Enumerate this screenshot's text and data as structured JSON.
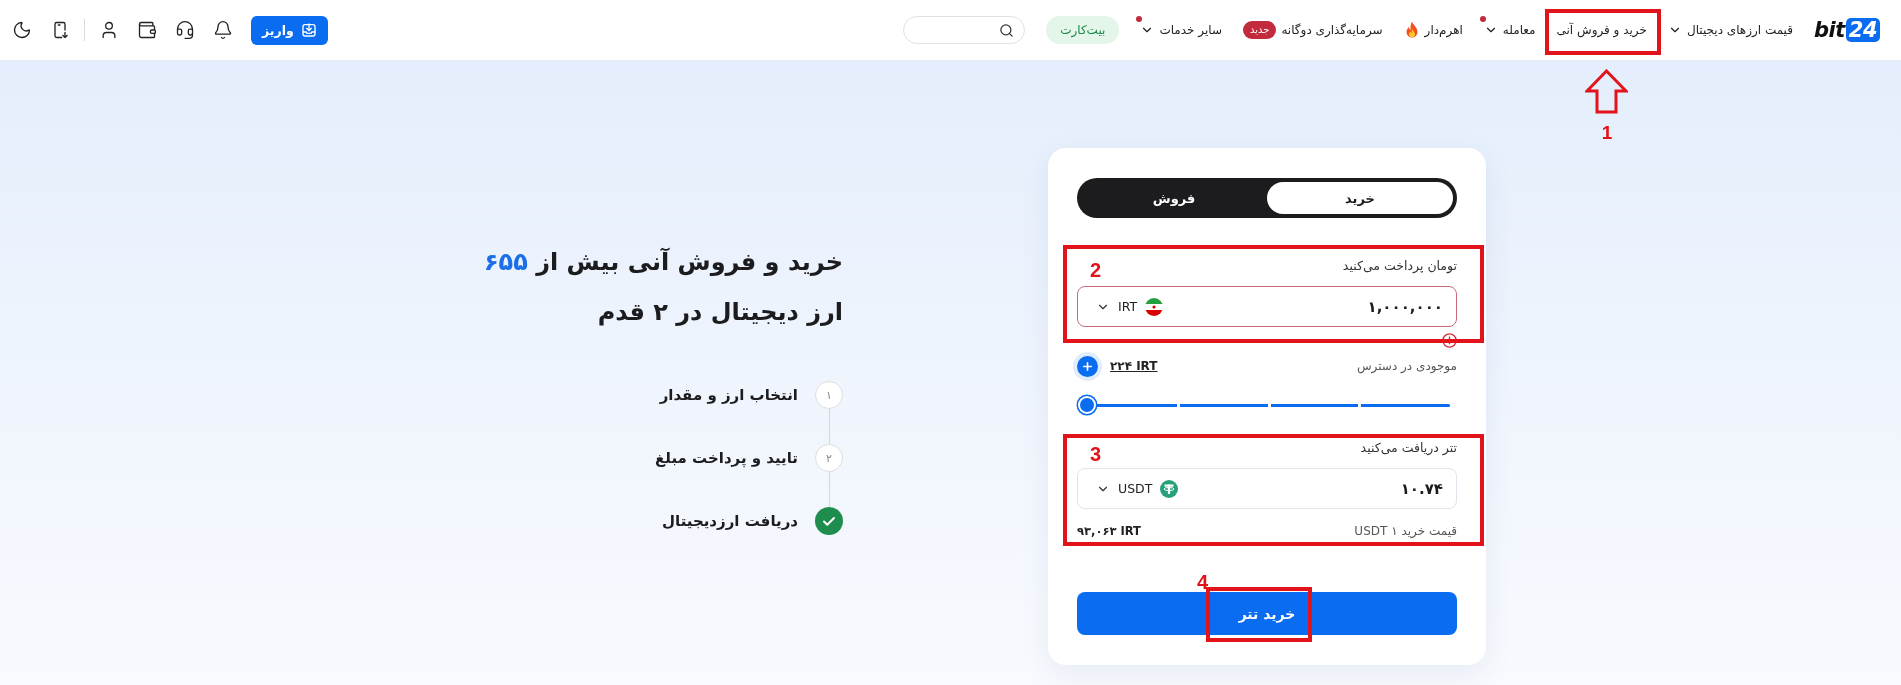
{
  "navbar": {
    "logo": {
      "word": "bit",
      "number": "24"
    },
    "menu": [
      {
        "label": "قیمت ارزهای دیجیتال",
        "kind": "dropdown",
        "dot": false
      },
      {
        "label": "خرید و فروش آنی",
        "kind": "link",
        "dot": false,
        "annotation": "1"
      },
      {
        "label": "معامله",
        "kind": "dropdown",
        "dot": true
      },
      {
        "label": "اهرم‌دار",
        "kind": "hot",
        "dot": false
      },
      {
        "label": "سرمایه‌گذاری دوگانه",
        "kind": "badge",
        "badge": "جدید",
        "dot": false
      },
      {
        "label": "سایر خدمات",
        "kind": "dropdown",
        "dot": true
      }
    ],
    "card_button": "بیت‌کارت",
    "deposit_button": "واریز"
  },
  "hero": {
    "title_start": "خرید و فروش آنی بیش از",
    "title_highlight": "۶۵۵",
    "title_end": "ارز دیجیتال در ۲ قدم",
    "steps": [
      {
        "number": "۱",
        "label": "انتخاب ارز و مقدار",
        "done": false
      },
      {
        "number": "۲",
        "label": "تایید و پرداخت مبلغ",
        "done": false
      },
      {
        "label": "دریافت ارزدیجیتال",
        "done": true
      }
    ]
  },
  "trade_card": {
    "tabs": [
      {
        "label": "خرید",
        "selected": true
      },
      {
        "label": "فروش",
        "selected": false
      }
    ],
    "pay": {
      "label": "تومان پرداخت می‌کنید",
      "value": "۱,۰۰۰,۰۰۰",
      "currency": "IRT",
      "error": true,
      "annotation": "2"
    },
    "balance": {
      "label": "موجودی در دسترس",
      "amount": "۲۲۴ IRT"
    },
    "slider": {
      "level": 1
    },
    "receive": {
      "label": "تتر دریافت می‌کنید",
      "value": "۱۰.۷۴",
      "currency": "USDT",
      "error": false,
      "annotation": "3"
    },
    "rate": {
      "label": "قیمت خرید ۱ USDT",
      "value": "۹۳,۰۶۳ IRT"
    },
    "submit": {
      "label": "خرید تتر",
      "annotation": "4"
    }
  }
}
